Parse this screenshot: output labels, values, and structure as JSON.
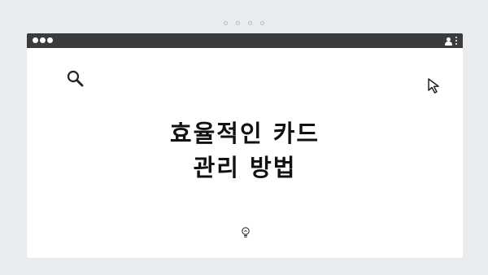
{
  "page": {
    "background": "#e8ecef",
    "titlebar_color": "#3b3b3b",
    "window_color": "#ffffff"
  },
  "titlebar": {
    "window_controls": [
      "dot",
      "dot",
      "dot"
    ],
    "right_icons": [
      "user-icon",
      "kebab-menu-icon"
    ]
  },
  "content": {
    "title_line1": "효율적인 카드",
    "title_line2": "관리 방법",
    "icons": [
      "search-icon",
      "cursor-arrow-icon",
      "lightbulb-icon"
    ]
  }
}
